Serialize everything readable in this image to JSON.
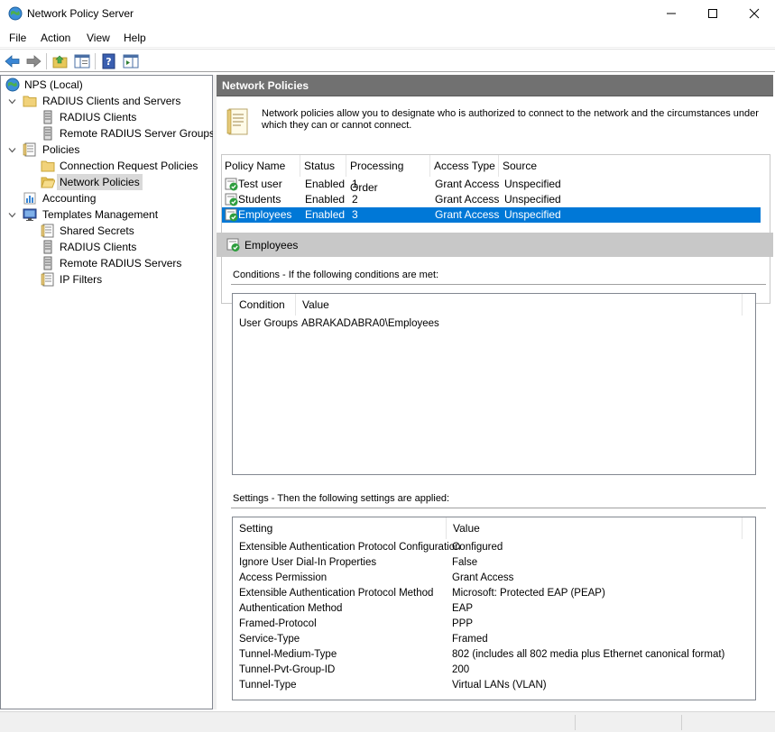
{
  "window": {
    "title": "Network Policy Server"
  },
  "menu": [
    "File",
    "Action",
    "View",
    "Help"
  ],
  "tree": {
    "root": "NPS (Local)",
    "radius_clients_servers": "RADIUS Clients and Servers",
    "radius_clients": "RADIUS Clients",
    "remote_radius_groups": "Remote RADIUS Server Groups",
    "policies": "Policies",
    "connection_request_policies": "Connection Request Policies",
    "network_policies": "Network Policies",
    "accounting": "Accounting",
    "templates_management": "Templates Management",
    "shared_secrets": "Shared Secrets",
    "tm_radius_clients": "RADIUS Clients",
    "remote_radius_servers": "Remote RADIUS Servers",
    "ip_filters": "IP Filters"
  },
  "panel": {
    "title": "Network Policies",
    "description": "Network policies allow you to designate who is authorized to connect to the network and the circumstances under which they can or cannot connect."
  },
  "policy_table": {
    "columns": [
      "Policy Name",
      "Status",
      "Processing Order",
      "Access Type",
      "Source"
    ],
    "rows": [
      [
        "Test user",
        "Enabled",
        "1",
        "Grant Access",
        "Unspecified"
      ],
      [
        "Students",
        "Enabled",
        "2",
        "Grant Access",
        "Unspecified"
      ],
      [
        "Employees",
        "Enabled",
        "3",
        "Grant Access",
        "Unspecified"
      ]
    ]
  },
  "details": {
    "title": "Employees",
    "conditions_label": "Conditions - If the following conditions are met:",
    "conditions_columns": [
      "Condition",
      "Value"
    ],
    "conditions_rows": [
      [
        "User Groups",
        "ABRAKADABRA0\\Employees"
      ]
    ],
    "settings_label": "Settings - Then the following settings are applied:",
    "settings_columns": [
      "Setting",
      "Value"
    ],
    "settings_rows": [
      [
        "Extensible Authentication Protocol Configuration",
        "Configured"
      ],
      [
        "Ignore User Dial-In Properties",
        "False"
      ],
      [
        "Access Permission",
        "Grant Access"
      ],
      [
        "Extensible Authentication Protocol Method",
        "Microsoft: Protected EAP (PEAP)"
      ],
      [
        "Authentication Method",
        "EAP"
      ],
      [
        "Framed-Protocol",
        "PPP"
      ],
      [
        "Service-Type",
        "Framed"
      ],
      [
        "Tunnel-Medium-Type",
        "802 (includes all 802 media plus Ethernet canonical format)"
      ],
      [
        "Tunnel-Pvt-Group-ID",
        "200"
      ],
      [
        "Tunnel-Type",
        "Virtual LANs (VLAN)"
      ]
    ]
  },
  "colors": {
    "selection": "#0078d7",
    "panel_header": "#717171",
    "details_header": "#c8c8c8"
  }
}
